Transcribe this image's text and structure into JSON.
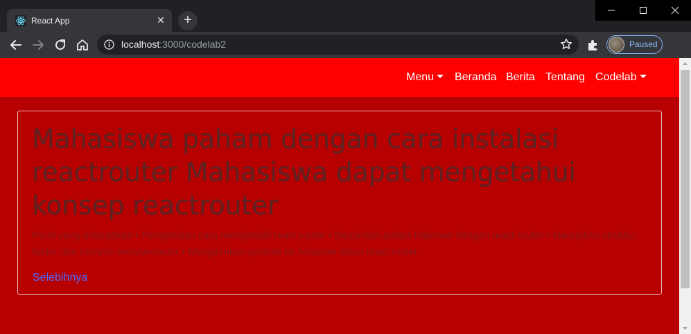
{
  "browser": {
    "tab_title": "React App",
    "tab_close": "✕",
    "new_tab": "+",
    "url_host": "localhost",
    "url_path": ":3000/codelab2",
    "profile_status": "Paused",
    "accent_color": "#8ab4f8"
  },
  "navbar": {
    "background_color": "#ff0000",
    "items": [
      {
        "label": "Menu",
        "has_dropdown": true
      },
      {
        "label": "Beranda",
        "has_dropdown": false
      },
      {
        "label": "Berita",
        "has_dropdown": false
      },
      {
        "label": "Tentang",
        "has_dropdown": false
      },
      {
        "label": "Codelab",
        "has_dropdown": true
      }
    ]
  },
  "content": {
    "background_color": "#b70000",
    "heading": "Mahasiswa paham dengan cara instalasi reactrouter Mahasiswa dapat mengetahui konsep reactrouter",
    "description": "Point yang diharapkan • Pengenalan cara menginstall react router • Berpindah antara halaman dengan react router • Merapikan struktur folder dan rename browserrouter • Mengirimkan params ke halaman detail react router",
    "link_label": "Selebihnya"
  }
}
